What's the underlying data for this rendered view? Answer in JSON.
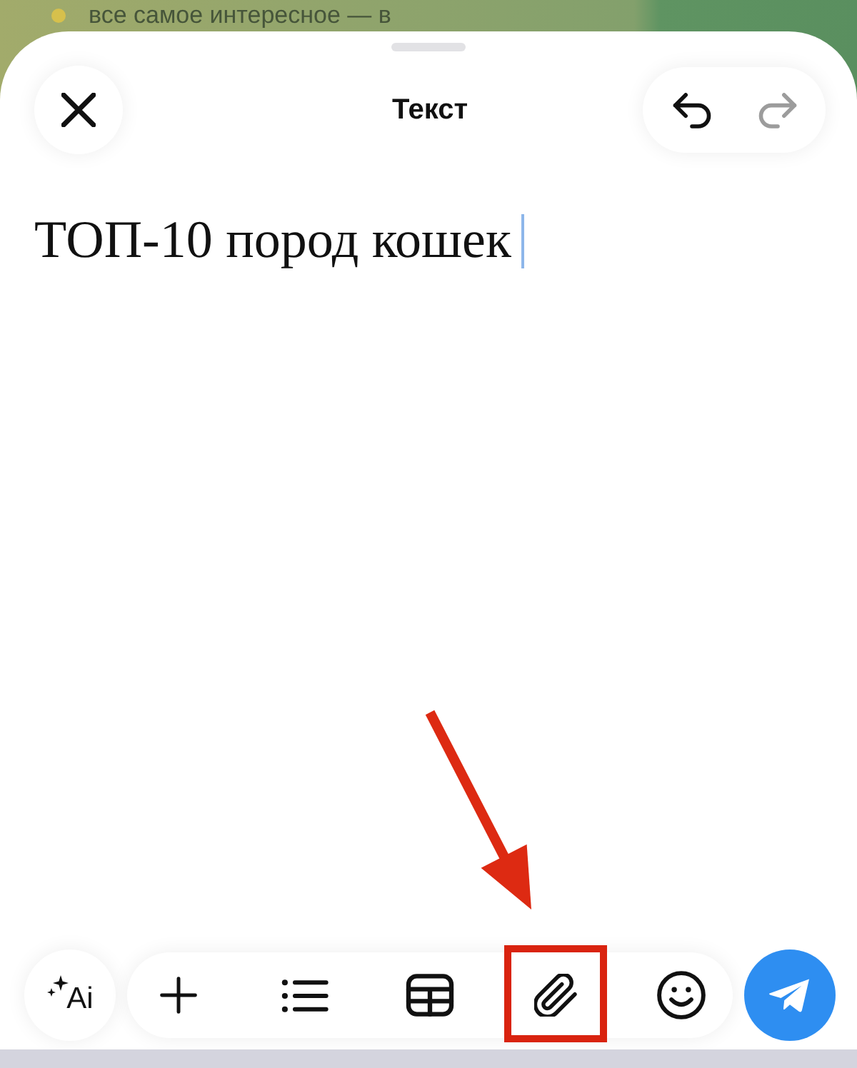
{
  "background": {
    "text": "все самое интересное — в"
  },
  "header": {
    "title": "Текст",
    "undo": {
      "disabled": false
    },
    "redo": {
      "disabled": true
    }
  },
  "editor": {
    "text": "ТОП-10 пород кошек",
    "cursor": true
  },
  "toolbar": {
    "ai_label": "Ai",
    "tools": [
      {
        "kind": "plus",
        "highlighted": false
      },
      {
        "kind": "list",
        "highlighted": false
      },
      {
        "kind": "table",
        "highlighted": false
      },
      {
        "kind": "clip",
        "highlighted": true
      },
      {
        "kind": "emoji",
        "highlighted": false
      }
    ]
  }
}
